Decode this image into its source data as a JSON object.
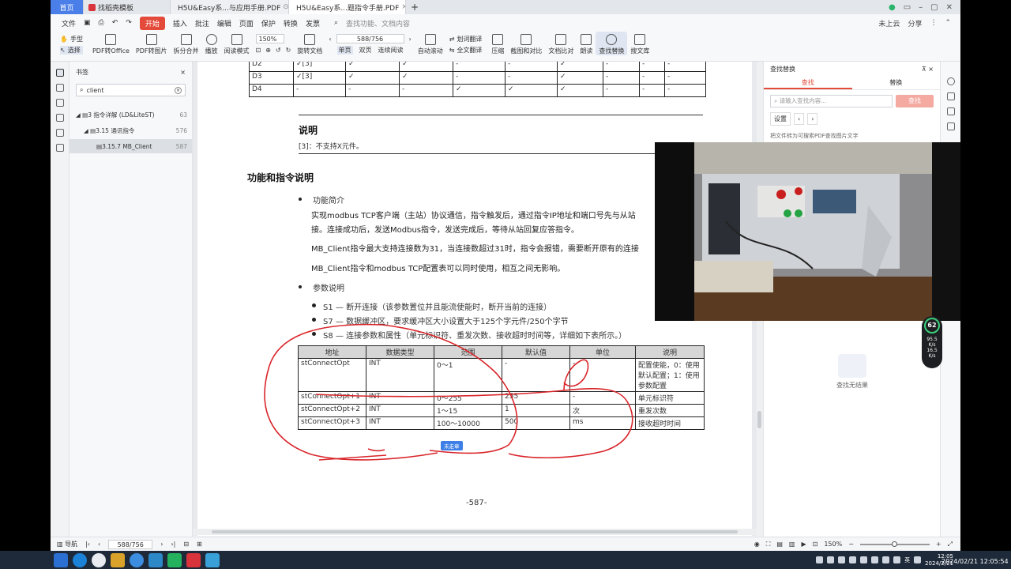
{
  "tabbar": {
    "tabs": [
      {
        "label": "首页"
      },
      {
        "label": "找稻壳模板"
      },
      {
        "label": "H5U&Easy系...与应用手册.PDF"
      },
      {
        "label": "H5U&Easy系...题指令手册.PDF"
      }
    ],
    "new_tab": "+"
  },
  "menubar": {
    "items": [
      "文件",
      "开始",
      "插入",
      "批注",
      "编辑",
      "页面",
      "保护",
      "转换",
      "发票"
    ],
    "search_placeholder": "查找功能、文档内容",
    "cloud_label": "未上云",
    "share_label": "分享"
  },
  "toolbar": {
    "hand_label": "手型",
    "select_label": "选择",
    "pdf_to_office": "PDF转Office",
    "pdf_to_image": "PDF转图片",
    "split_merge": "拆分合并",
    "play": "播放",
    "read_mode": "阅读模式",
    "zoom_value": "150%",
    "page_value": "588/756",
    "rotate": "旋转文档",
    "single": "单页",
    "double": "双页",
    "continuous": "连续阅读",
    "auto_scroll": "自动滚动",
    "word_translate": "划词翻译",
    "full_translate": "全文翻译",
    "compress": "压缩",
    "screenshot": "截图和对比",
    "doc_compare": "文档比对",
    "read_aloud": "朗读",
    "find_replace": "查找替换",
    "search_lib": "搜文库"
  },
  "bookmarks": {
    "title": "书签",
    "search_value": "client",
    "items": [
      {
        "label": "3 指令详解 (LD&LiteST)",
        "page": "63"
      },
      {
        "label": "3.15 通讯指令",
        "page": "576"
      },
      {
        "label": "3.15.7 MB_Client",
        "page": "587"
      }
    ]
  },
  "doc": {
    "top_table": [
      {
        "name": "D2",
        "c1": "✓[3]",
        "c2": "✓",
        "c3": "✓",
        "c4": "-",
        "c5": "-",
        "c6": "✓",
        "c7": "-",
        "c8": "-",
        "c9": "-"
      },
      {
        "name": "D3",
        "c1": "✓[3]",
        "c2": "✓",
        "c3": "✓",
        "c4": "-",
        "c5": "-",
        "c6": "✓",
        "c7": "-",
        "c8": "-",
        "c9": "-"
      },
      {
        "name": "D4",
        "c1": "-",
        "c2": "-",
        "c3": "-",
        "c4": "✓",
        "c5": "✓",
        "c6": "✓",
        "c7": "-",
        "c8": "-",
        "c9": "-"
      }
    ],
    "note_title": "说明",
    "note_text": "[3]：不支持X元件。",
    "section_title": "功能和指令说明",
    "intro_bullet": "功能简介",
    "intro_lines": [
      "实现modbus TCP客户端（主站）协议通信，指令触发后，通过指令IP地址和端口号先与从站",
      "接。连接成功后，发送Modbus指令，发送完成后，等待从站回复应答指令。",
      "MB_Client指令最大支持连接数为31，当连接数超过31时，指令会报错，需要断开原有的连接",
      "MB_Client指令和modbus TCP配置表可以同时使用，相互之间无影响。"
    ],
    "param_bullet": "参数说明",
    "params": [
      "S1 — 断开连接（该参数置位并且能流使能时，断开当前的连接）",
      "S7 — 数据缓冲区，要求缓冲区大小设置大于125个字元件/250个字节",
      "S8 — 连接参数和属性（单元标识符、重发次数、接收超时时间等，详细如下表所示。）"
    ],
    "param_table": {
      "headers": [
        "地址",
        "数据类型",
        "范围",
        "默认值",
        "单位",
        "说明"
      ],
      "rows": [
        [
          "stConnectOpt",
          "INT",
          "0～1",
          "-",
          "-",
          "配置使能，0：使用默认配置；1：使用参数配置"
        ],
        [
          "stConnectOpt+1",
          "INT",
          "0～255",
          "255",
          "-",
          "单元标识符"
        ],
        [
          "stConnectOpt+2",
          "INT",
          "1～15",
          "1",
          "次",
          "重发次数"
        ],
        [
          "stConnectOpt+3",
          "INT",
          "100～10000",
          "500",
          "ms",
          "接收超时时间"
        ]
      ]
    },
    "collapse_tag": "未走章",
    "page_number": "-587-"
  },
  "findpanel": {
    "title": "查找替换",
    "tab_find": "查找",
    "tab_replace": "替换",
    "input_placeholder": "请输入查找内容...",
    "find_button": "查找",
    "settings": "设置",
    "hint": "把文件转为可搜索PDF查找图片文字",
    "empty": "查找无结果"
  },
  "statusbar": {
    "nav": "导航",
    "page": "588/756",
    "zoom": "150%"
  },
  "gauge": {
    "value": "62",
    "up": "95.5",
    "down": "16.5",
    "unit": "K/s"
  },
  "taskbar": {
    "time": "12:05",
    "date": "2024/2/21",
    "timestamp": "2024/02/21 12:05:54",
    "lang": "英"
  },
  "colors": {
    "accent": "#e44a3a",
    "home_tab": "#4a7ee8",
    "annotation": "#d9252a",
    "taskbar": "#1e2a3a"
  }
}
